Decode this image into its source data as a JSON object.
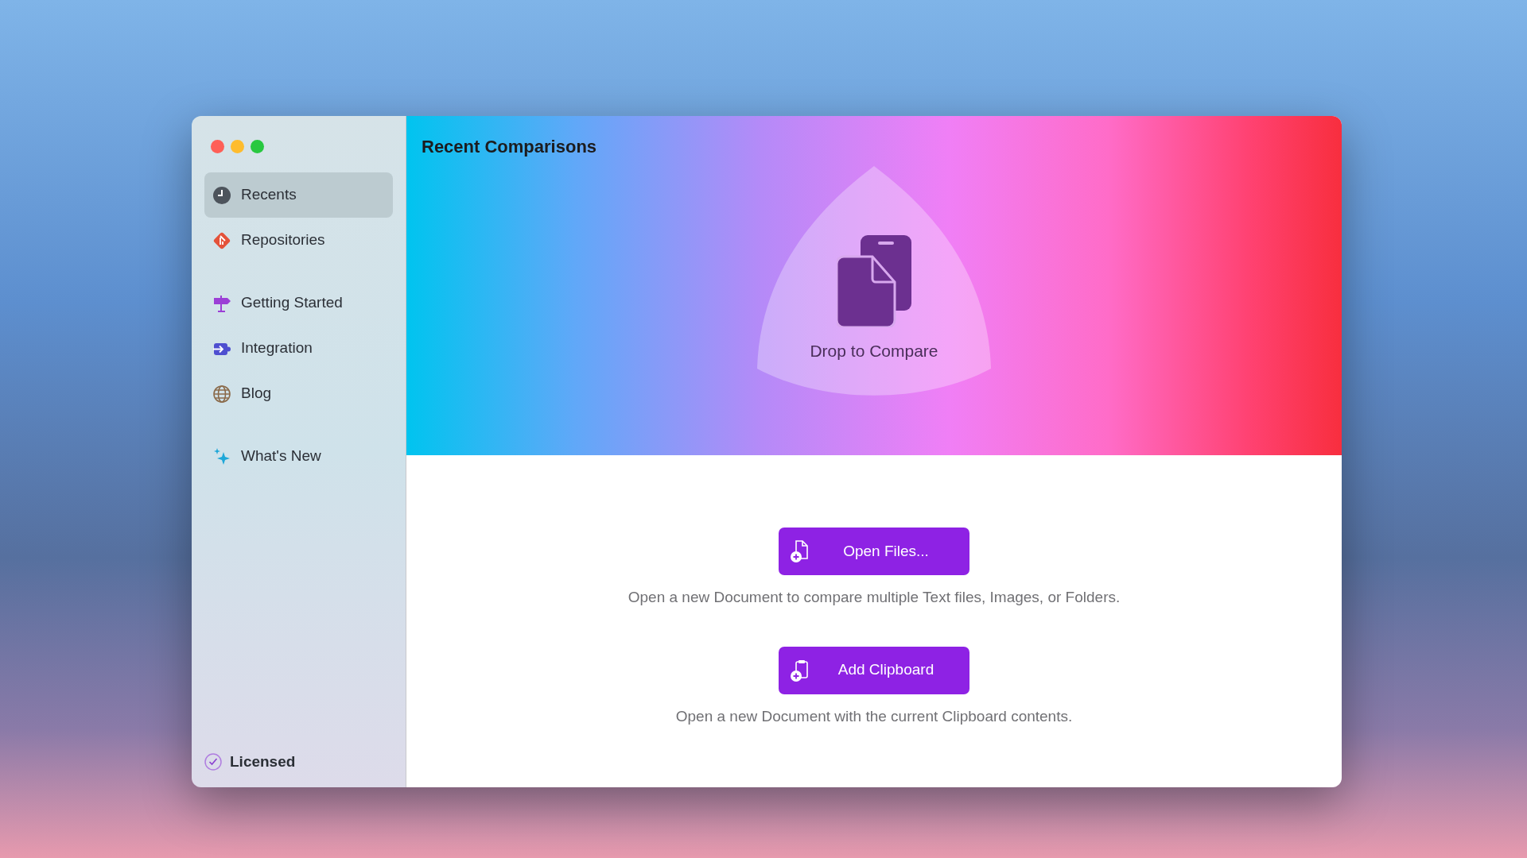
{
  "window": {
    "title": "Recent Comparisons"
  },
  "sidebar": {
    "sections": [
      [
        {
          "label": "Recents",
          "kind": "clock",
          "selected": true
        },
        {
          "label": "Repositories",
          "kind": "git",
          "selected": false
        }
      ],
      [
        {
          "label": "Getting Started",
          "kind": "signpost",
          "selected": false
        },
        {
          "label": "Integration",
          "kind": "plugin",
          "selected": false
        },
        {
          "label": "Blog",
          "kind": "globe",
          "selected": false
        }
      ],
      [
        {
          "label": "What's New",
          "kind": "sparkles",
          "selected": false
        }
      ]
    ],
    "footer": {
      "label": "Licensed",
      "checked": true
    }
  },
  "drop_zone": {
    "label": "Drop to Compare"
  },
  "actions": [
    {
      "label": "Open Files...",
      "kind": "file",
      "description": "Open a new Document to compare multiple Text files, Images, or Folders."
    },
    {
      "label": "Add Clipboard",
      "kind": "clipboard",
      "description": "Open a new Document with the current Clipboard contents."
    }
  ]
}
